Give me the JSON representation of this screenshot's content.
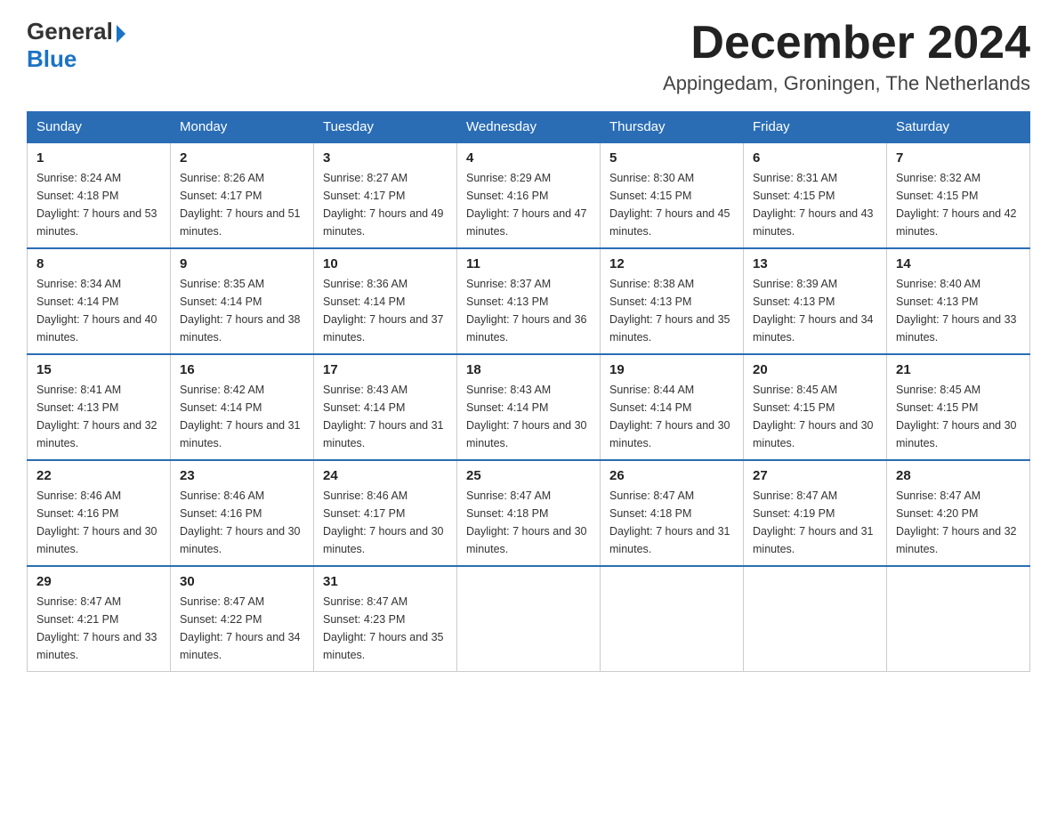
{
  "logo": {
    "general": "General",
    "blue": "Blue",
    "arrow": "▶"
  },
  "title": "December 2024",
  "location": "Appingedam, Groningen, The Netherlands",
  "days_of_week": [
    "Sunday",
    "Monday",
    "Tuesday",
    "Wednesday",
    "Thursday",
    "Friday",
    "Saturday"
  ],
  "weeks": [
    [
      {
        "day": "1",
        "sunrise": "8:24 AM",
        "sunset": "4:18 PM",
        "daylight": "7 hours and 53 minutes."
      },
      {
        "day": "2",
        "sunrise": "8:26 AM",
        "sunset": "4:17 PM",
        "daylight": "7 hours and 51 minutes."
      },
      {
        "day": "3",
        "sunrise": "8:27 AM",
        "sunset": "4:17 PM",
        "daylight": "7 hours and 49 minutes."
      },
      {
        "day": "4",
        "sunrise": "8:29 AM",
        "sunset": "4:16 PM",
        "daylight": "7 hours and 47 minutes."
      },
      {
        "day": "5",
        "sunrise": "8:30 AM",
        "sunset": "4:15 PM",
        "daylight": "7 hours and 45 minutes."
      },
      {
        "day": "6",
        "sunrise": "8:31 AM",
        "sunset": "4:15 PM",
        "daylight": "7 hours and 43 minutes."
      },
      {
        "day": "7",
        "sunrise": "8:32 AM",
        "sunset": "4:15 PM",
        "daylight": "7 hours and 42 minutes."
      }
    ],
    [
      {
        "day": "8",
        "sunrise": "8:34 AM",
        "sunset": "4:14 PM",
        "daylight": "7 hours and 40 minutes."
      },
      {
        "day": "9",
        "sunrise": "8:35 AM",
        "sunset": "4:14 PM",
        "daylight": "7 hours and 38 minutes."
      },
      {
        "day": "10",
        "sunrise": "8:36 AM",
        "sunset": "4:14 PM",
        "daylight": "7 hours and 37 minutes."
      },
      {
        "day": "11",
        "sunrise": "8:37 AM",
        "sunset": "4:13 PM",
        "daylight": "7 hours and 36 minutes."
      },
      {
        "day": "12",
        "sunrise": "8:38 AM",
        "sunset": "4:13 PM",
        "daylight": "7 hours and 35 minutes."
      },
      {
        "day": "13",
        "sunrise": "8:39 AM",
        "sunset": "4:13 PM",
        "daylight": "7 hours and 34 minutes."
      },
      {
        "day": "14",
        "sunrise": "8:40 AM",
        "sunset": "4:13 PM",
        "daylight": "7 hours and 33 minutes."
      }
    ],
    [
      {
        "day": "15",
        "sunrise": "8:41 AM",
        "sunset": "4:13 PM",
        "daylight": "7 hours and 32 minutes."
      },
      {
        "day": "16",
        "sunrise": "8:42 AM",
        "sunset": "4:14 PM",
        "daylight": "7 hours and 31 minutes."
      },
      {
        "day": "17",
        "sunrise": "8:43 AM",
        "sunset": "4:14 PM",
        "daylight": "7 hours and 31 minutes."
      },
      {
        "day": "18",
        "sunrise": "8:43 AM",
        "sunset": "4:14 PM",
        "daylight": "7 hours and 30 minutes."
      },
      {
        "day": "19",
        "sunrise": "8:44 AM",
        "sunset": "4:14 PM",
        "daylight": "7 hours and 30 minutes."
      },
      {
        "day": "20",
        "sunrise": "8:45 AM",
        "sunset": "4:15 PM",
        "daylight": "7 hours and 30 minutes."
      },
      {
        "day": "21",
        "sunrise": "8:45 AM",
        "sunset": "4:15 PM",
        "daylight": "7 hours and 30 minutes."
      }
    ],
    [
      {
        "day": "22",
        "sunrise": "8:46 AM",
        "sunset": "4:16 PM",
        "daylight": "7 hours and 30 minutes."
      },
      {
        "day": "23",
        "sunrise": "8:46 AM",
        "sunset": "4:16 PM",
        "daylight": "7 hours and 30 minutes."
      },
      {
        "day": "24",
        "sunrise": "8:46 AM",
        "sunset": "4:17 PM",
        "daylight": "7 hours and 30 minutes."
      },
      {
        "day": "25",
        "sunrise": "8:47 AM",
        "sunset": "4:18 PM",
        "daylight": "7 hours and 30 minutes."
      },
      {
        "day": "26",
        "sunrise": "8:47 AM",
        "sunset": "4:18 PM",
        "daylight": "7 hours and 31 minutes."
      },
      {
        "day": "27",
        "sunrise": "8:47 AM",
        "sunset": "4:19 PM",
        "daylight": "7 hours and 31 minutes."
      },
      {
        "day": "28",
        "sunrise": "8:47 AM",
        "sunset": "4:20 PM",
        "daylight": "7 hours and 32 minutes."
      }
    ],
    [
      {
        "day": "29",
        "sunrise": "8:47 AM",
        "sunset": "4:21 PM",
        "daylight": "7 hours and 33 minutes."
      },
      {
        "day": "30",
        "sunrise": "8:47 AM",
        "sunset": "4:22 PM",
        "daylight": "7 hours and 34 minutes."
      },
      {
        "day": "31",
        "sunrise": "8:47 AM",
        "sunset": "4:23 PM",
        "daylight": "7 hours and 35 minutes."
      },
      null,
      null,
      null,
      null
    ]
  ]
}
